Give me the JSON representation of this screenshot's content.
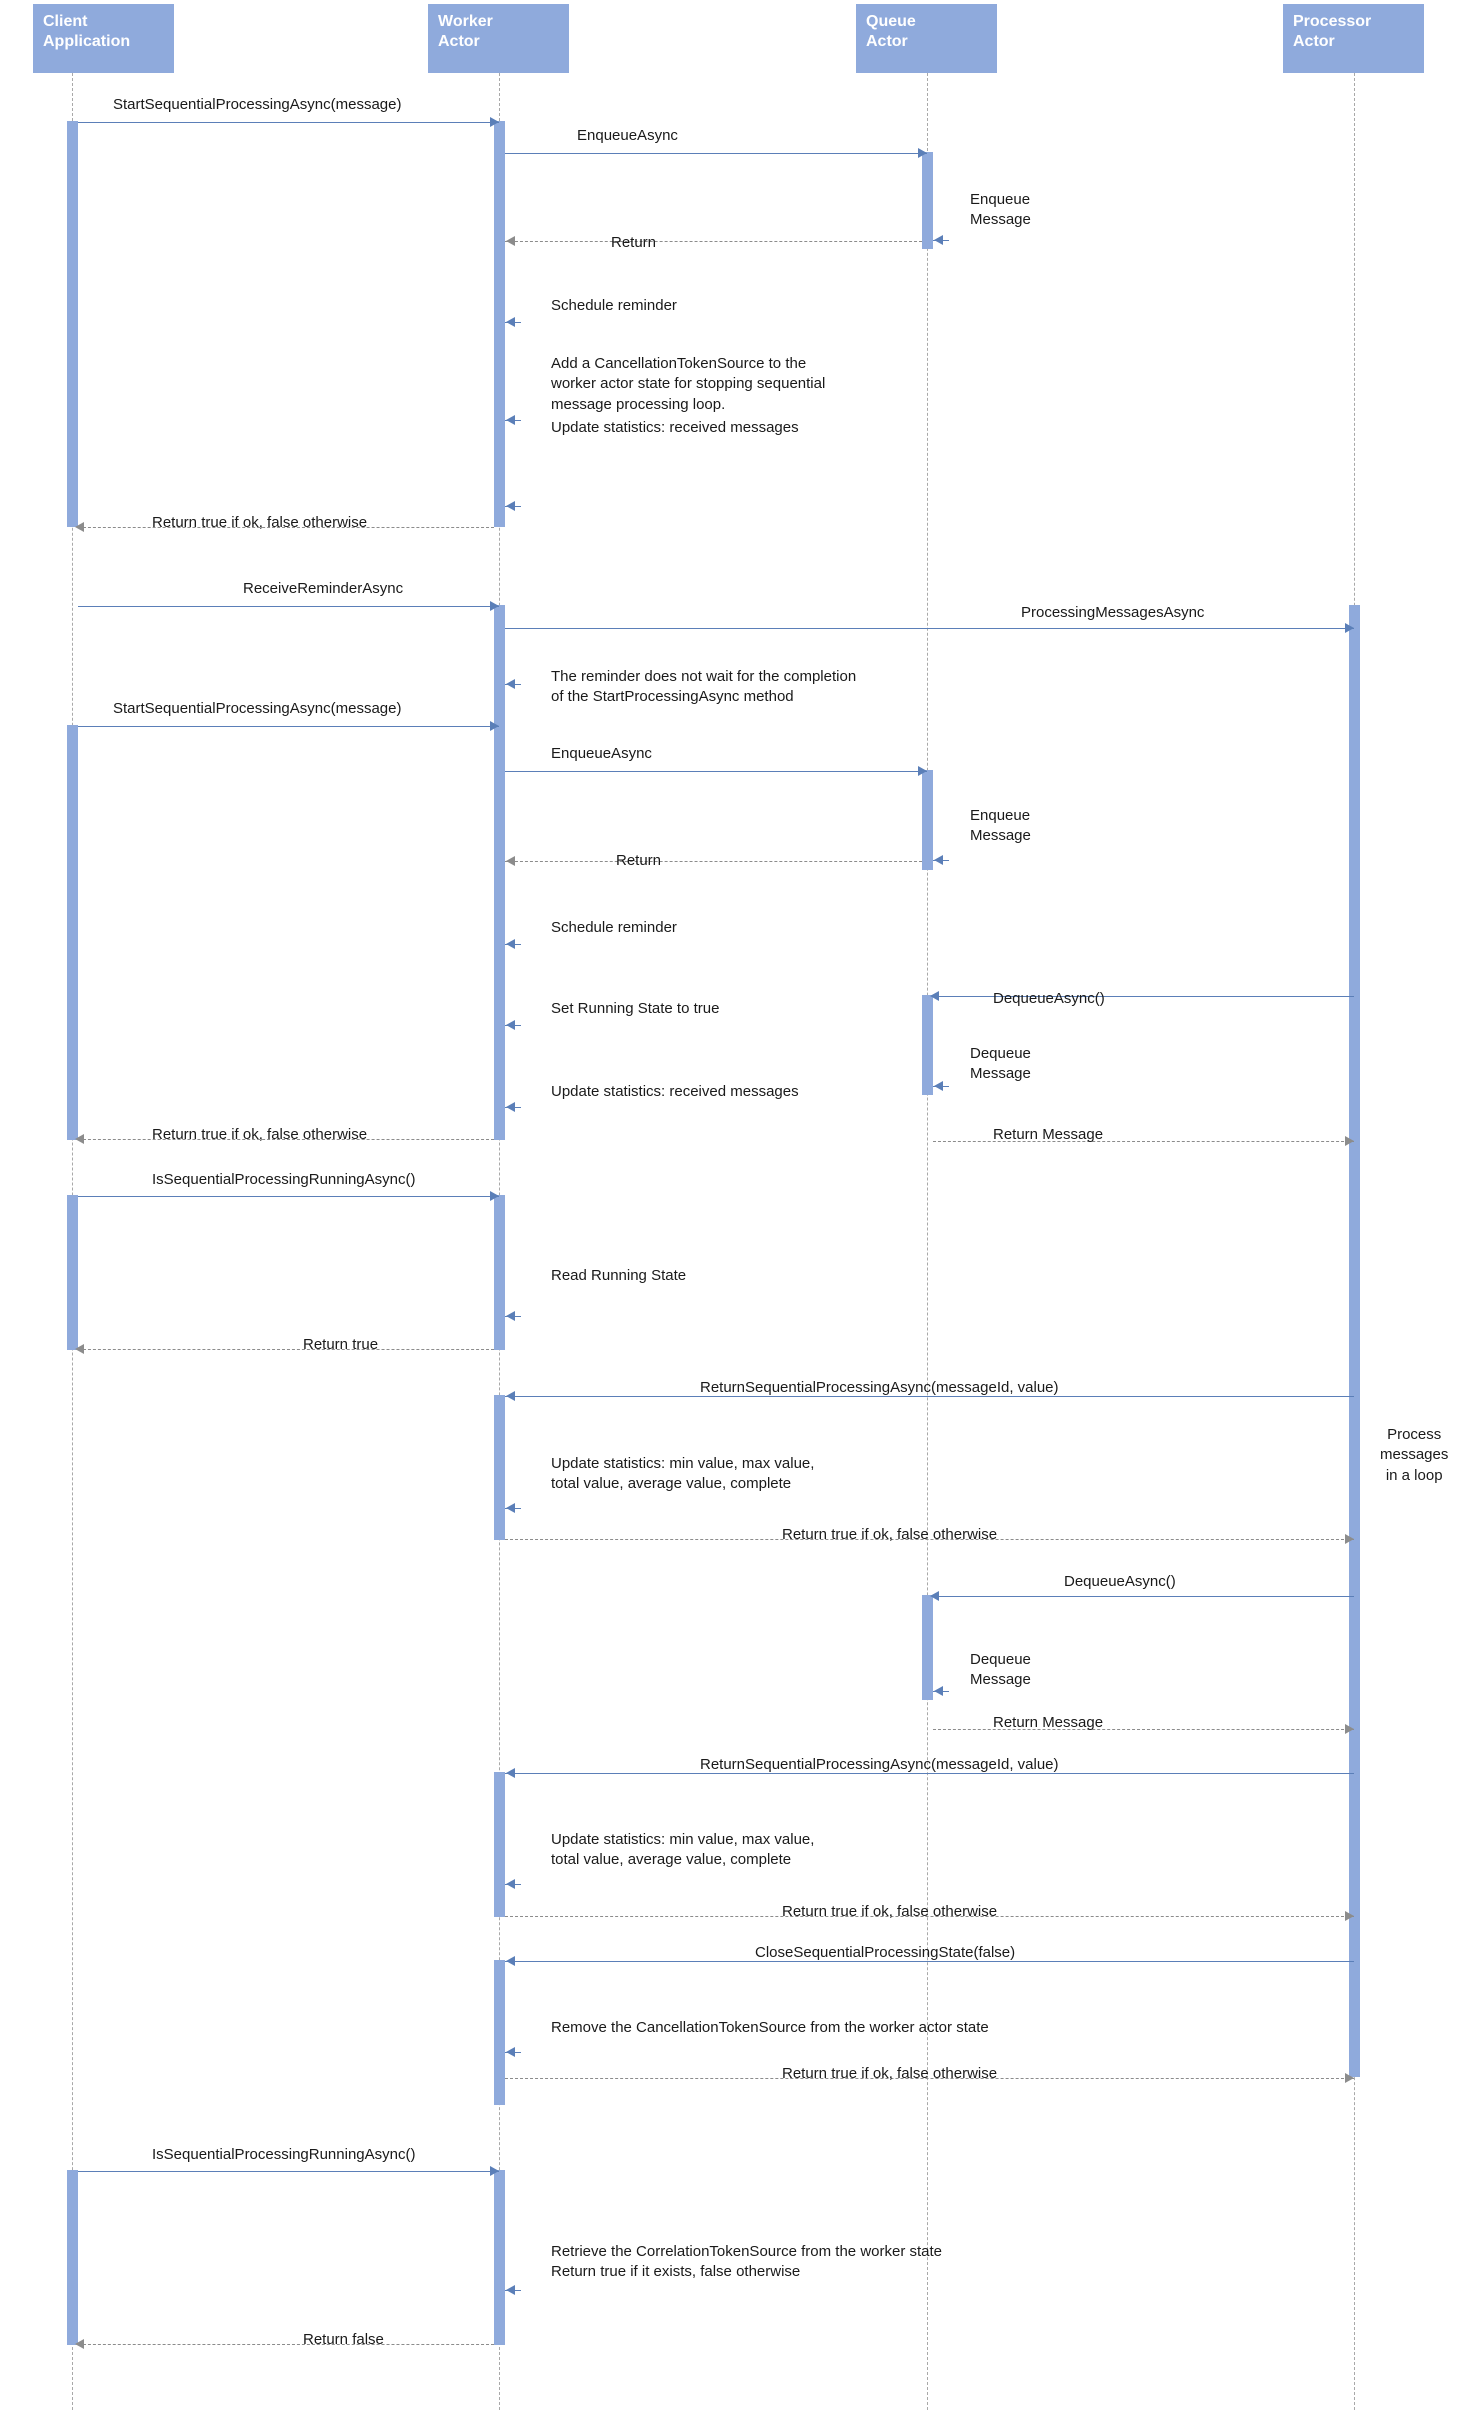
{
  "title": "Sequential message processing sequence diagram",
  "actors": [
    {
      "id": "client",
      "name": "Client\nApplication"
    },
    {
      "id": "worker",
      "name": "Worker\nActor"
    },
    {
      "id": "queue",
      "name": "Queue\nActor"
    },
    {
      "id": "processor",
      "name": "Processor\nActor"
    }
  ],
  "colors": {
    "actor_fill": "#8faadc",
    "actor_text": "#ffffff",
    "activation_fill": "#8faadc",
    "solid_arrow": "#5b7fb8",
    "dashed_arrow": "#8c8c8c",
    "lifeline": "#a9a9a9",
    "label_text": "#1a1a1a"
  },
  "messages": [
    {
      "id": "m1",
      "text": "StartSequentialProcessingAsync(message)",
      "from": "client",
      "to": "worker",
      "style": "solid"
    },
    {
      "id": "m2",
      "text": "EnqueueAsync",
      "from": "worker",
      "to": "queue",
      "style": "solid"
    },
    {
      "id": "m3",
      "text": "Enqueue\nMessage",
      "from": "queue",
      "to": "queue",
      "style": "self"
    },
    {
      "id": "m4",
      "text": "Return",
      "from": "queue",
      "to": "worker",
      "style": "dashed"
    },
    {
      "id": "m5",
      "text": "Schedule reminder",
      "from": "worker",
      "to": "worker",
      "style": "self"
    },
    {
      "id": "m6",
      "text": "Add a  CancellationTokenSource to the\nworker actor state for stopping sequential\nmessage processing loop.",
      "from": "worker",
      "to": "worker",
      "style": "self"
    },
    {
      "id": "m7",
      "text": "Update statistics: received messages",
      "from": "worker",
      "to": "worker",
      "style": "self"
    },
    {
      "id": "m8",
      "text": "Return true if ok, false otherwise",
      "from": "worker",
      "to": "client",
      "style": "dashed"
    },
    {
      "id": "m9",
      "text": "ReceiveReminderAsync",
      "from": "client",
      "to": "worker",
      "style": "solid"
    },
    {
      "id": "m10",
      "text": "ProcessingMessagesAsync",
      "from": "worker",
      "to": "processor",
      "style": "solid"
    },
    {
      "id": "m11",
      "text": "The reminder does not wait for the completion\nof the StartProcessingAsync method",
      "from": "worker",
      "to": "worker",
      "style": "self"
    },
    {
      "id": "m12",
      "text": "StartSequentialProcessingAsync(message)",
      "from": "client",
      "to": "worker",
      "style": "solid"
    },
    {
      "id": "m13",
      "text": "EnqueueAsync",
      "from": "worker",
      "to": "queue",
      "style": "solid"
    },
    {
      "id": "m14",
      "text": "Enqueue\nMessage",
      "from": "queue",
      "to": "queue",
      "style": "self"
    },
    {
      "id": "m15",
      "text": "Return",
      "from": "queue",
      "to": "worker",
      "style": "dashed"
    },
    {
      "id": "m16",
      "text": "Schedule reminder",
      "from": "worker",
      "to": "worker",
      "style": "self"
    },
    {
      "id": "m17",
      "text": "Set Running State to true",
      "from": "worker",
      "to": "worker",
      "style": "self"
    },
    {
      "id": "m18",
      "text": "DequeueAsync()",
      "from": "processor",
      "to": "queue",
      "style": "solid"
    },
    {
      "id": "m19",
      "text": "Dequeue\nMessage",
      "from": "queue",
      "to": "queue",
      "style": "self"
    },
    {
      "id": "m20",
      "text": "Update statistics: received messages",
      "from": "worker",
      "to": "worker",
      "style": "self"
    },
    {
      "id": "m21",
      "text": "Return true if ok, false otherwise",
      "from": "worker",
      "to": "client",
      "style": "dashed"
    },
    {
      "id": "m22",
      "text": "Return Message",
      "from": "queue",
      "to": "processor",
      "style": "dashed"
    },
    {
      "id": "m23",
      "text": "IsSequentialProcessingRunningAsync()",
      "from": "client",
      "to": "worker",
      "style": "solid"
    },
    {
      "id": "m24",
      "text": "Read Running State",
      "from": "worker",
      "to": "worker",
      "style": "self"
    },
    {
      "id": "m25",
      "text": "Return true",
      "from": "worker",
      "to": "client",
      "style": "dashed"
    },
    {
      "id": "m26",
      "text": "ReturnSequentialProcessingAsync(messageId, value)",
      "from": "processor",
      "to": "worker",
      "style": "solid"
    },
    {
      "id": "m27",
      "text": "Update statistics: min value, max value,\ntotal value, average value, complete",
      "from": "worker",
      "to": "worker",
      "style": "self"
    },
    {
      "id": "m28",
      "text": "Return true if ok, false otherwise",
      "from": "worker",
      "to": "processor",
      "style": "dashed"
    },
    {
      "id": "m29",
      "text": "DequeueAsync()",
      "from": "processor",
      "to": "queue",
      "style": "solid"
    },
    {
      "id": "m30",
      "text": "Dequeue\nMessage",
      "from": "queue",
      "to": "queue",
      "style": "self"
    },
    {
      "id": "m31",
      "text": "Return Message",
      "from": "queue",
      "to": "processor",
      "style": "dashed"
    },
    {
      "id": "m32",
      "text": "ReturnSequentialProcessingAsync(messageId, value)",
      "from": "processor",
      "to": "worker",
      "style": "solid"
    },
    {
      "id": "m33",
      "text": "Update statistics: min value, max value,\ntotal value, average value, complete",
      "from": "worker",
      "to": "worker",
      "style": "self"
    },
    {
      "id": "m34",
      "text": "Return true if ok, false otherwise",
      "from": "worker",
      "to": "processor",
      "style": "dashed"
    },
    {
      "id": "m35",
      "text": "CloseSequentialProcessingState(false)",
      "from": "processor",
      "to": "worker",
      "style": "solid"
    },
    {
      "id": "m36",
      "text": "Remove the CancellationTokenSource from the worker actor state",
      "from": "worker",
      "to": "worker",
      "style": "self"
    },
    {
      "id": "m37",
      "text": "Return true if ok, false otherwise",
      "from": "worker",
      "to": "processor",
      "style": "dashed"
    },
    {
      "id": "m38",
      "text": "IsSequentialProcessingRunningAsync()",
      "from": "client",
      "to": "worker",
      "style": "solid"
    },
    {
      "id": "m39",
      "text": "Retrieve the CorrelationTokenSource from the worker state\nReturn true if it exists, false otherwise",
      "from": "worker",
      "to": "worker",
      "style": "self"
    },
    {
      "id": "m40",
      "text": "Return false",
      "from": "worker",
      "to": "client",
      "style": "dashed"
    }
  ],
  "notes": [
    {
      "id": "n1",
      "text": "Process\nmessages\n in a loop"
    }
  ]
}
